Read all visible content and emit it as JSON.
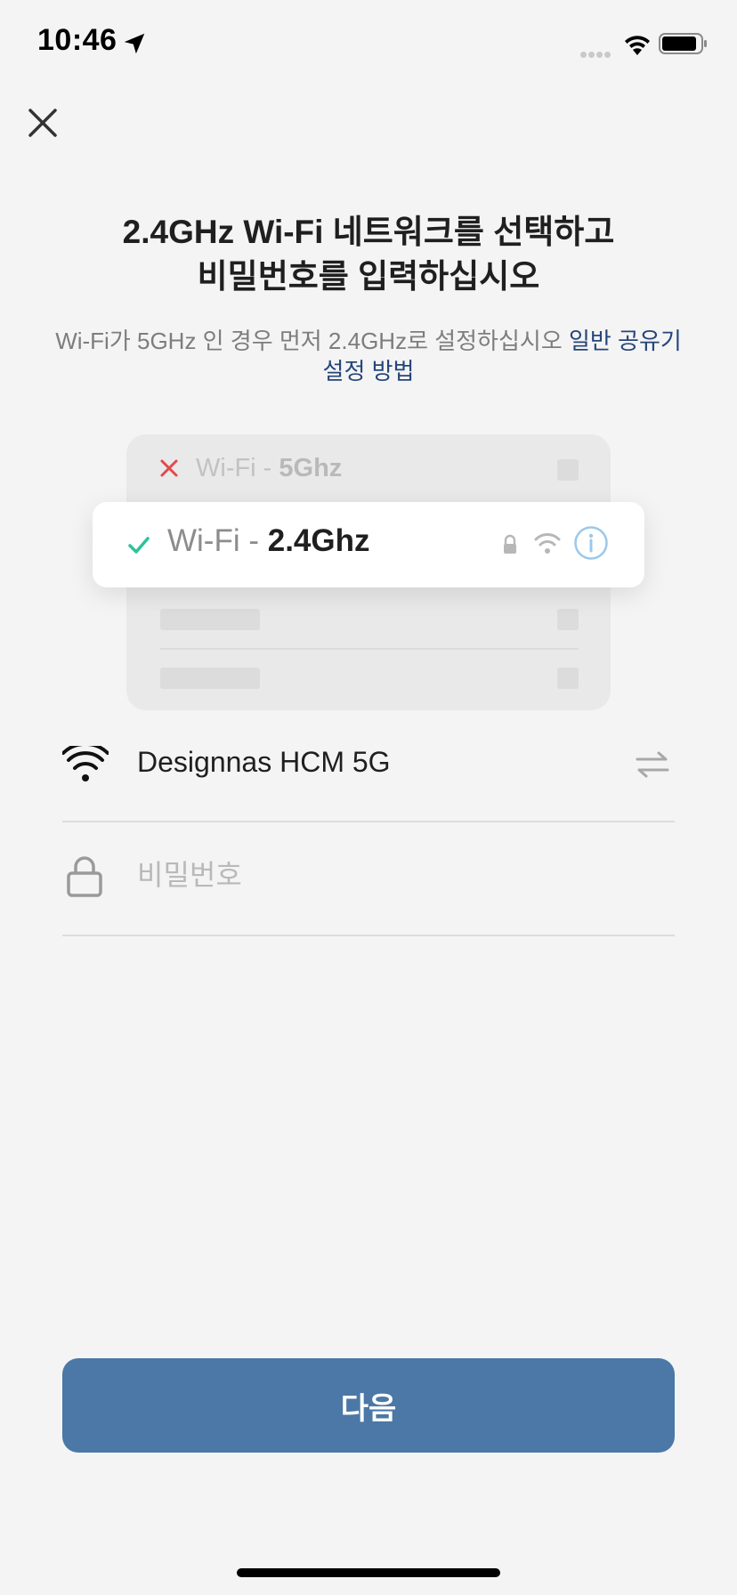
{
  "status_bar": {
    "time": "10:46"
  },
  "header": {
    "title_line1": "2.4GHz Wi-Fi 네트워크를 선택하고",
    "title_line2": "비밀번호를 입력하십시오",
    "subtitle_text": "Wi-Fi가 5GHz 인 경우 먼저 2.4GHz로 설정하십시오 ",
    "subtitle_link": "일반 공유기 설정 방법"
  },
  "illustration": {
    "bad_prefix": "Wi-Fi - ",
    "bad_band": "5Ghz",
    "good_prefix": "Wi-Fi - ",
    "good_band": "2.4Ghz"
  },
  "form": {
    "ssid": "Designnas HCM 5G",
    "password_placeholder": "비밀번호"
  },
  "actions": {
    "next_label": "다음"
  },
  "colors": {
    "background": "#f4f4f4",
    "primary_button": "#4b78a6",
    "link": "#25457a",
    "check": "#2cc39a",
    "cross": "#e5484d",
    "info": "#9cc8ea"
  }
}
